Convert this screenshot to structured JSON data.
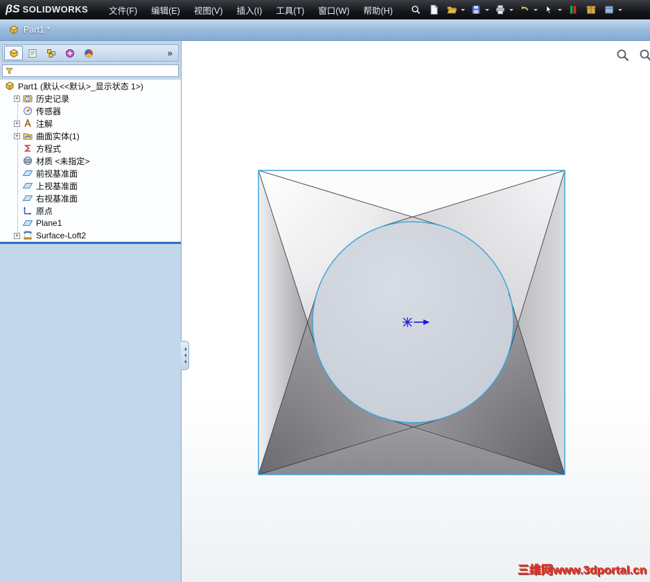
{
  "menubar": {
    "logo_mark": "βS",
    "logo_text": "SOLIDWORKS",
    "menus": [
      "文件(F)",
      "编辑(E)",
      "视图(V)",
      "插入(I)",
      "工具(T)",
      "窗口(W)",
      "帮助(H)"
    ],
    "toolbar_icons": [
      "search-icon",
      "new-document-icon",
      "open-folder-icon",
      "save-icon",
      "print-icon",
      "undo-icon",
      "select-cursor-icon",
      "toolbox-icon",
      "box-icon",
      "options-icon"
    ]
  },
  "titlebar": {
    "title": "Part1 *"
  },
  "panel": {
    "tabs": [
      "featuremanager",
      "propertymanager",
      "configurationmanager",
      "dimxpertmanager",
      "displaymanager"
    ],
    "expand_button": "»",
    "filter": {
      "value": ""
    },
    "tree": {
      "expand_glyph": "+",
      "root_label": "Part1 (默认<<默认>_显示状态 1>)",
      "items": [
        {
          "label": "历史记录",
          "icon": "history",
          "expandable": true
        },
        {
          "label": "传感器",
          "icon": "sensors",
          "expandable": false
        },
        {
          "label": "注解",
          "icon": "annotations",
          "expandable": true
        },
        {
          "label": "曲面实体(1)",
          "icon": "surface-bodies",
          "expandable": true
        },
        {
          "label": "方程式",
          "icon": "equations",
          "expandable": false
        },
        {
          "label": "材质 <未指定>",
          "icon": "material",
          "expandable": false
        },
        {
          "label": "前视基准面",
          "icon": "plane",
          "expandable": false
        },
        {
          "label": "上视基准面",
          "icon": "plane",
          "expandable": false
        },
        {
          "label": "右视基准面",
          "icon": "plane",
          "expandable": false
        },
        {
          "label": "原点",
          "icon": "origin",
          "expandable": false
        },
        {
          "label": "Plane1",
          "icon": "plane",
          "expandable": false
        },
        {
          "label": "Surface-Loft2",
          "icon": "surface-loft",
          "expandable": true
        }
      ]
    }
  },
  "viewport": {
    "model": "square-to-circle loft surface with origin marker",
    "zoom_icons": [
      "magnifier-icon",
      "magnifier-icon"
    ],
    "watermark": "三维网www.3dportal.cn"
  },
  "colors": {
    "edge_highlight": "#3aa6da",
    "rollback_bar": "#2f6fc1",
    "watermark_red": "#e03222",
    "panel_background": "#c3d7ea",
    "origin_blue": "#1b1bdc"
  }
}
